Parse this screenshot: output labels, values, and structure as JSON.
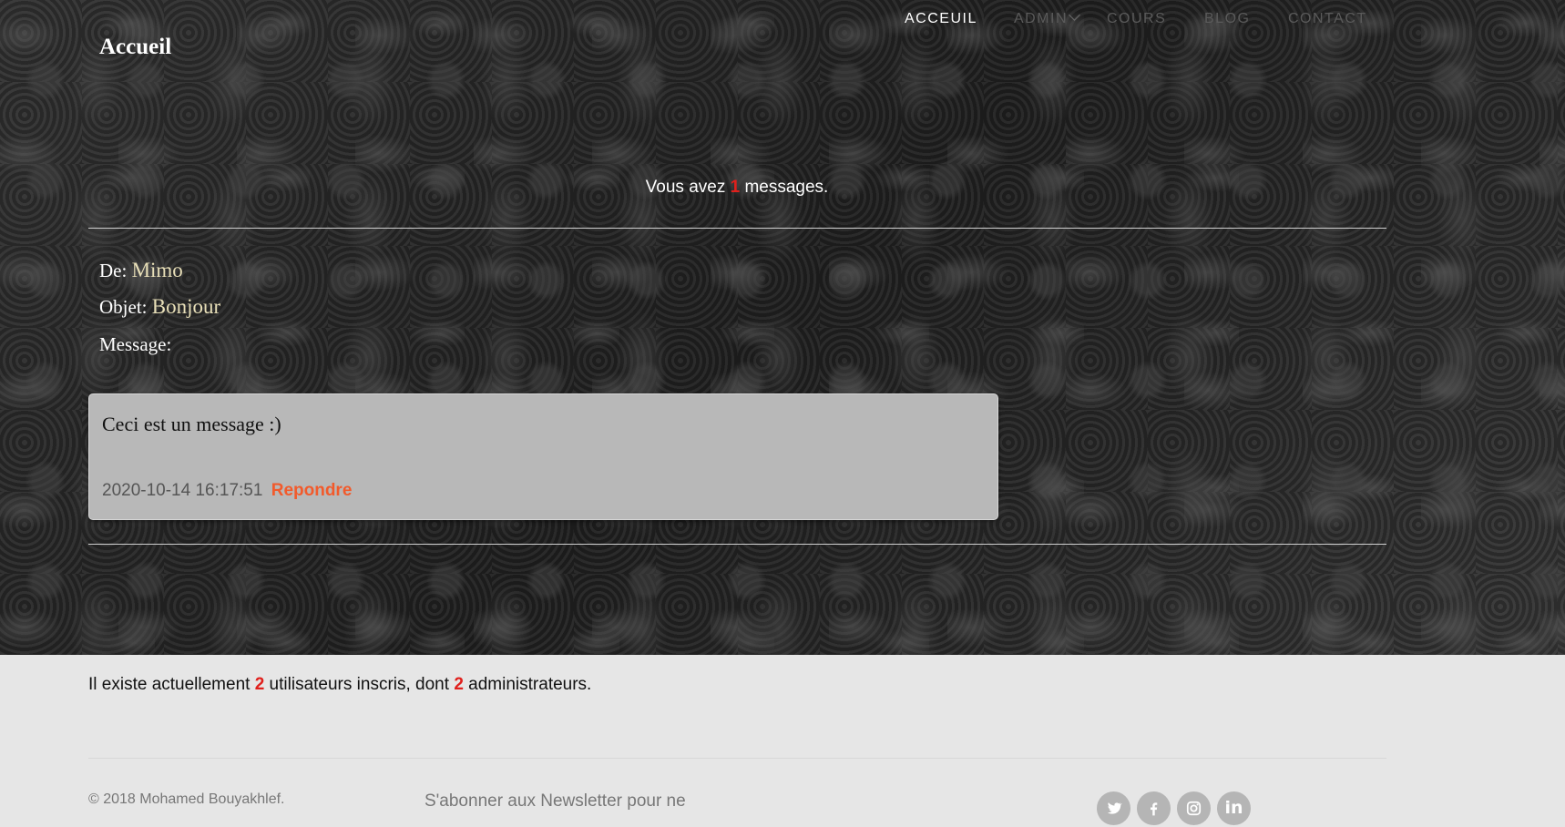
{
  "brand": {
    "title": "Accueil"
  },
  "nav": {
    "items": [
      {
        "label": "ACCEUIL",
        "active": true
      },
      {
        "label": "ADMIN",
        "active": false,
        "has_dropdown": true
      },
      {
        "label": "COURS",
        "active": false
      },
      {
        "label": "BLOG",
        "active": false
      },
      {
        "label": "CONTACT",
        "active": false
      }
    ]
  },
  "inbox": {
    "prefix": "Vous avez ",
    "count": "1",
    "suffix": " messages."
  },
  "message": {
    "from_label": "De:",
    "from_value": "Mimo",
    "subject_label": "Objet:",
    "subject_value": "Bonjour",
    "message_label": "Message:",
    "body": "Ceci est un message :)",
    "date": "2020-10-14 16:17:51",
    "reply_label": "Repondre"
  },
  "stats": {
    "prefix": "Il existe actuellement ",
    "users": "2",
    "middle": " utilisateurs inscris, dont ",
    "admins": "2",
    "suffix": " administrateurs."
  },
  "footer": {
    "copyright": "© 2018 Mohamed Bouyakhlef.",
    "newsletter": "S'abonner aux Newsletter pour ne",
    "social": [
      "twitter-icon",
      "facebook-icon",
      "instagram-icon",
      "linkedin-icon"
    ]
  },
  "colors": {
    "accent_red": "#e0201c",
    "reply_orange": "#f25a2b",
    "footer_bg": "#e6e6e6"
  }
}
